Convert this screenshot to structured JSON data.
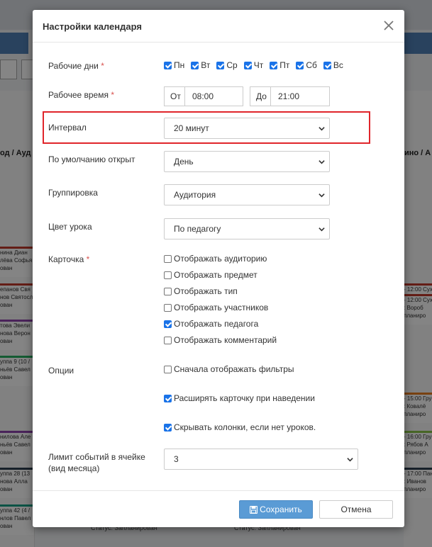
{
  "background": {
    "col_head_left": "од / Ауд 2",
    "col_head_right": "ино / А",
    "cards_left": [
      {
        "l1": "нина Диан",
        "l2": "лёва Софья",
        "l3": "ован",
        "color": "#c0392b"
      },
      {
        "l1": "епанов Свя",
        "l2": "нов Святосла",
        "l3": "ован",
        "color": "#c0392b"
      },
      {
        "l1": "това Эвели",
        "l2": "нова Верон",
        "l3": "ован",
        "color": "#8e44ad"
      },
      {
        "l1": "уппа 9 (10 /",
        "l2": "ньёв Савел",
        "l3": "ован",
        "color": "#27ae60"
      },
      {
        "l1": "нилова Але",
        "l2": "ньёв Савел",
        "l3": "ован",
        "color": "#8e44ad"
      },
      {
        "l1": "уппа 28 (13",
        "l2": "нова Алла",
        "l3": "ован",
        "color": "#2c3e50"
      },
      {
        "l1": "уппа 42 (4 /",
        "l2": "нлов Павел",
        "l3": "ован",
        "color": "#16a085"
      }
    ],
    "cards_right": [
      {
        "l1": "- 12:00 Сух",
        "l2": ": Вороб",
        "l3": "планиро",
        "color": "#c0392b"
      },
      {
        "l1": "- 12:00 Сух",
        "l2": ": Вороб",
        "l3": "планиро",
        "color": "#c0392b"
      },
      {
        "l1": "- 15:00 Гру",
        "l2": ": Ковалё",
        "l3": "планиро",
        "color": "#e67e22"
      },
      {
        "l1": "- 16:00 Гру",
        "l2": ": Рябов А",
        "l3": "планиро",
        "color": "#8bc34a"
      },
      {
        "l1": "- 17:00 Пан",
        "l2": ": Иванов",
        "l3": "планиро",
        "color": "#2c3e50"
      }
    ],
    "foot_status": "Статус: Запланирован"
  },
  "modal": {
    "title": "Настройки календаря",
    "workdays": {
      "label": "Рабочие дни",
      "required_mark": "*",
      "days": [
        {
          "label": "Пн",
          "checked": true
        },
        {
          "label": "Вт",
          "checked": true
        },
        {
          "label": "Ср",
          "checked": true
        },
        {
          "label": "Чт",
          "checked": true
        },
        {
          "label": "Пт",
          "checked": true
        },
        {
          "label": "Сб",
          "checked": true
        },
        {
          "label": "Вс",
          "checked": true
        }
      ]
    },
    "worktime": {
      "label": "Рабочее время",
      "required_mark": "*",
      "from_label": "От",
      "from_value": "08:00",
      "to_label": "До",
      "to_value": "21:00"
    },
    "interval": {
      "label": "Интервал",
      "value": "20 минут"
    },
    "default_open": {
      "label": "По умолчанию открыт",
      "value": "День"
    },
    "grouping": {
      "label": "Группировка",
      "value": "Аудитория"
    },
    "lesson_color": {
      "label": "Цвет урока",
      "value": "По педагогу"
    },
    "card": {
      "label": "Карточка",
      "required_mark": "*",
      "options": [
        {
          "label": "Отображать аудиторию",
          "checked": false
        },
        {
          "label": "Отображать предмет",
          "checked": false
        },
        {
          "label": "Отображать тип",
          "checked": false
        },
        {
          "label": "Отображать участников",
          "checked": false
        },
        {
          "label": "Отображать педагога",
          "checked": true
        },
        {
          "label": "Отображать комментарий",
          "checked": false
        }
      ]
    },
    "options": {
      "label": "Опции",
      "items": [
        {
          "label": "Сначала отображать фильтры",
          "checked": false
        },
        {
          "label": "Расширять карточку при наведении",
          "checked": true
        },
        {
          "label": "Скрывать колонки, если нет уроков.",
          "checked": true
        }
      ]
    },
    "event_limit": {
      "label_line1": "Лимит событий в ячейке",
      "label_line2": "(вид месяца)",
      "value": "3"
    },
    "save_label": "Сохранить",
    "cancel_label": "Отмена"
  },
  "colors": {
    "accent": "#1a73e8",
    "save_button": "#5a9bd5",
    "highlight": "#e0252b"
  }
}
